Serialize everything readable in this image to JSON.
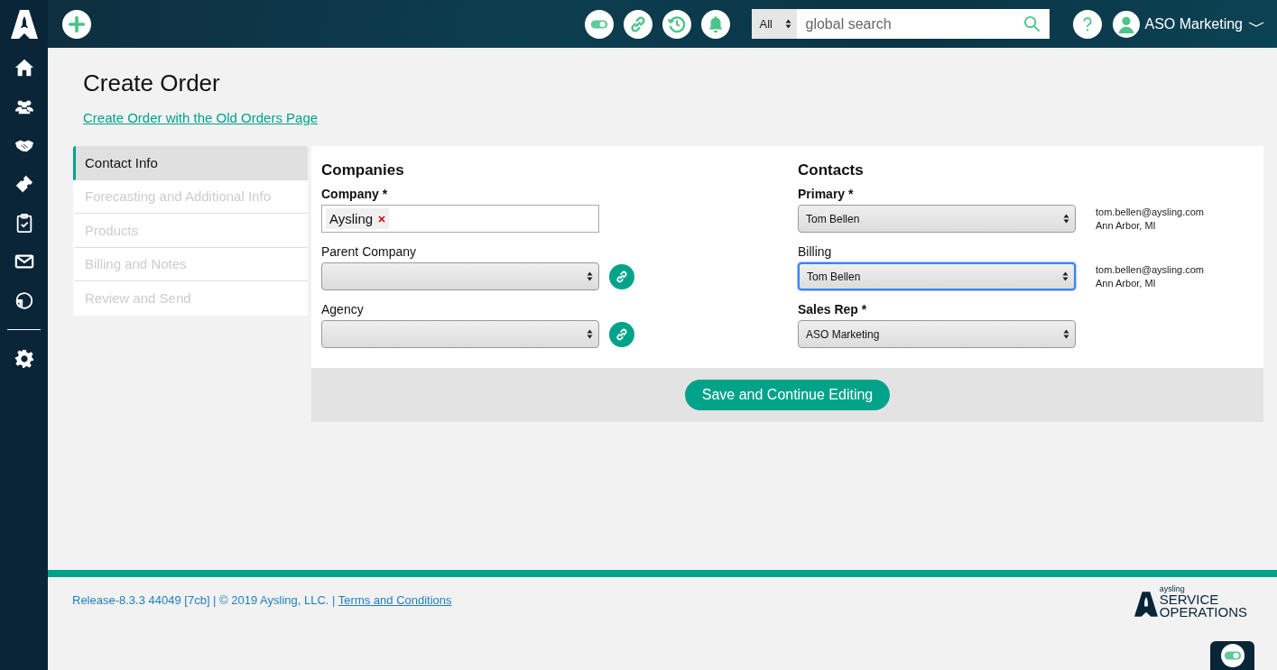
{
  "header": {
    "search_scope": "All",
    "search_placeholder": "global search",
    "user": "ASO Marketing"
  },
  "page": {
    "title": "Create Order",
    "link": "Create Order with the Old Orders Page"
  },
  "steps": [
    {
      "label": "Contact Info",
      "selected": true,
      "disabled": false
    },
    {
      "label": "Forecasting and Additional Info",
      "selected": false,
      "disabled": true
    },
    {
      "label": "Products",
      "selected": false,
      "disabled": true
    },
    {
      "label": "Billing and Notes",
      "selected": false,
      "disabled": true
    },
    {
      "label": "Review and Send",
      "selected": false,
      "disabled": true
    }
  ],
  "companies": {
    "heading": "Companies",
    "fields": [
      {
        "label": "Company *",
        "kind": "tags",
        "tags": [
          "Aysling"
        ]
      },
      {
        "label": "Parent Company",
        "kind": "select",
        "link_button": true
      },
      {
        "label": "Agency",
        "kind": "select",
        "link_button": true
      }
    ]
  },
  "contacts": {
    "heading": "Contacts",
    "fields": [
      {
        "label": "Primary *",
        "kind": "select",
        "value": "Tom Bellen",
        "focused": false,
        "email": "tom.bellen@aysling.com",
        "location": "Ann Arbor, MI"
      },
      {
        "label": "Billing",
        "kind": "select",
        "value": "Tom Bellen",
        "focused": true,
        "email": "tom.bellen@aysling.com",
        "location": "Ann Arbor, MI"
      },
      {
        "label": "Sales Rep *",
        "kind": "select",
        "value": "ASO Marketing",
        "focused": false
      }
    ]
  },
  "save_button": "Save and Continue Editing",
  "footer": {
    "release": "Release-8.3.3 44049 [7cb] | © 2019 Aysling, LLC. |",
    "terms": "Terms and Conditions",
    "logo_small": "aysling",
    "logo_line1": "SERVICE",
    "logo_line2": "OPERATIONS"
  }
}
